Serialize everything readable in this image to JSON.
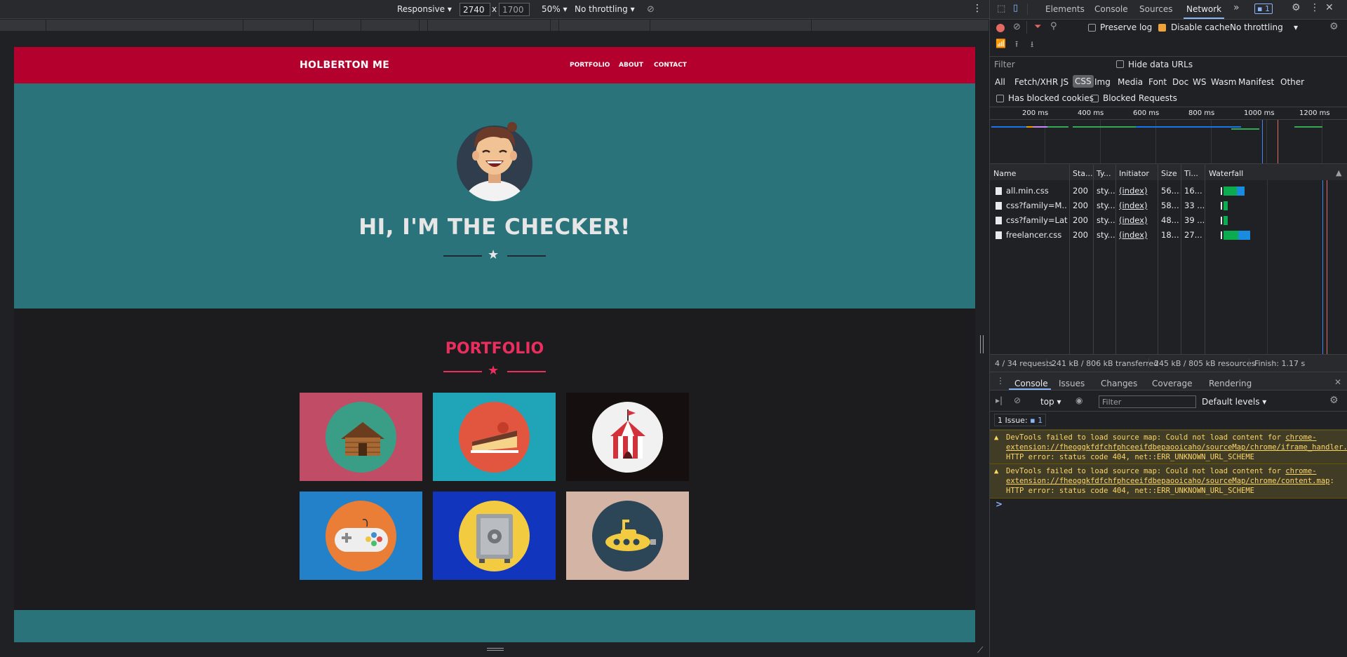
{
  "device_toolbar": {
    "device": "Responsive",
    "width": "2740",
    "times": "x",
    "height": "1700",
    "zoom": "50%",
    "throttling": "No throttling"
  },
  "site": {
    "brand": "HOLBERTON ME",
    "nav": [
      "PORTFOLIO",
      "ABOUT",
      "CONTACT"
    ],
    "hero_title": "HI, I'M THE CHECKER!",
    "portfolio_title": "PORTFOLIO",
    "tiles": [
      {
        "name": "cabin",
        "bg": "#c04c66",
        "circle": "#3a9e86"
      },
      {
        "name": "cake",
        "bg": "#20a4b8",
        "circle": "#e2563f"
      },
      {
        "name": "circus",
        "bg": "#15100f",
        "circle": "#f1f1f1"
      },
      {
        "name": "game-controller",
        "bg": "#2381c9",
        "circle": "#ea7e37"
      },
      {
        "name": "safe",
        "bg": "#1235bd",
        "circle": "#f3cb40"
      },
      {
        "name": "submarine",
        "bg": "#d4b4a5",
        "circle": "#2c4658"
      }
    ],
    "colors": {
      "nav": "#b4002c",
      "hero": "#2a737a",
      "accent": "#ea2e5d"
    }
  },
  "devtools": {
    "tabs": [
      "Elements",
      "Console",
      "Sources",
      "Network"
    ],
    "issues_badge": "1",
    "network": {
      "preserve_log": "Preserve log",
      "disable_cache": "Disable cache",
      "throttling": "No throttling",
      "filter_placeholder": "Filter",
      "hide_data_urls": "Hide data URLs",
      "types": [
        "All",
        "Fetch/XHR",
        "JS",
        "CSS",
        "Img",
        "Media",
        "Font",
        "Doc",
        "WS",
        "Wasm",
        "Manifest",
        "Other"
      ],
      "has_blocked_cookies": "Has blocked cookies",
      "blocked_requests": "Blocked Requests",
      "timeline_ticks": [
        "200 ms",
        "400 ms",
        "600 ms",
        "800 ms",
        "1000 ms",
        "1200 ms"
      ],
      "columns": [
        "Name",
        "Sta...",
        "Ty...",
        "Initiator",
        "Size",
        "Ti...",
        "Waterfall"
      ],
      "rows": [
        {
          "name": "all.min.css",
          "status": "200",
          "type": "sty...",
          "initiator": "(index)",
          "size": "56....",
          "time": "16...",
          "wf_start": 0.12,
          "wf_wait": 0.1,
          "wf_dl": 0.06
        },
        {
          "name": "css?family=M...",
          "status": "200",
          "type": "sty...",
          "initiator": "(index)",
          "size": "58...",
          "time": "33 ...",
          "wf_start": 0.12,
          "wf_wait": 0.03,
          "wf_dl": 0.0
        },
        {
          "name": "css?family=Lat...",
          "status": "200",
          "type": "sty...",
          "initiator": "(index)",
          "size": "48...",
          "time": "39 ...",
          "wf_start": 0.12,
          "wf_wait": 0.03,
          "wf_dl": 0.0
        },
        {
          "name": "freelancer.css",
          "status": "200",
          "type": "sty...",
          "initiator": "(index)",
          "size": "18...",
          "time": "27...",
          "wf_start": 0.12,
          "wf_wait": 0.11,
          "wf_dl": 0.09
        }
      ],
      "summary": [
        "4 / 34 requests",
        "241 kB / 806 kB transferred",
        "245 kB / 805 kB resources",
        "Finish: 1.17 s"
      ]
    },
    "drawer_tabs": [
      "Console",
      "Issues",
      "Changes",
      "Coverage",
      "Rendering"
    ],
    "console": {
      "context": "top",
      "filter_placeholder": "Filter",
      "levels": "Default levels",
      "issues_label": "1 Issue:",
      "issues_count": "1",
      "warnings": [
        {
          "prefix": "DevTools failed to load source map: Could not load content for ",
          "link": "chrome-extension://fheoggkfdfchfphceeifdbepaooicaho/sourceMap/chrome/iframe_handler.map",
          "suffix": ": HTTP error: status code 404, net::ERR_UNKNOWN_URL_SCHEME"
        },
        {
          "prefix": "DevTools failed to load source map: Could not load content for ",
          "link": "chrome-extension://fheoggkfdfchfphceeifdbepaooicaho/sourceMap/chrome/content.map",
          "suffix": ": HTTP error: status code 404, net::ERR_UNKNOWN_URL_SCHEME"
        }
      ],
      "prompt": ">"
    }
  }
}
